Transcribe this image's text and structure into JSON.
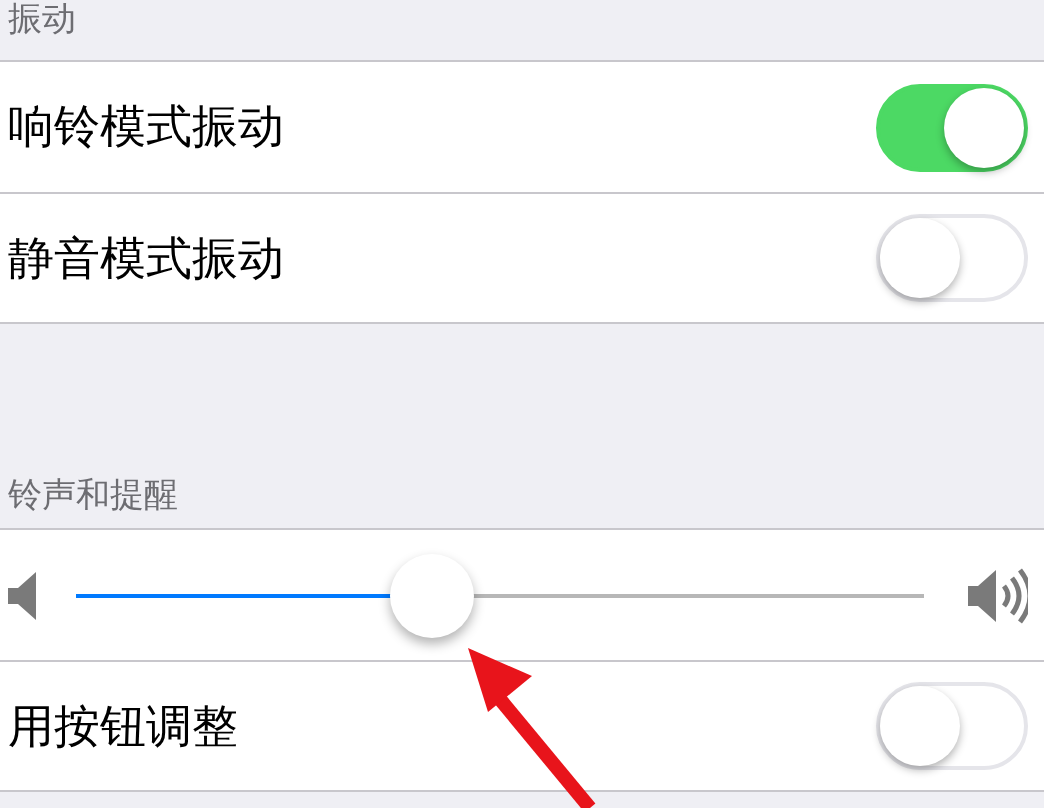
{
  "sections": [
    {
      "header": "振动",
      "rows": [
        {
          "kind": "toggle",
          "label": "响铃模式振动",
          "on": true
        },
        {
          "kind": "toggle",
          "label": "静音模式振动",
          "on": false
        }
      ]
    },
    {
      "header": "铃声和提醒",
      "rows": [
        {
          "kind": "slider",
          "level": 0.42
        },
        {
          "kind": "toggle",
          "label": "用按钮调整",
          "on": false
        }
      ]
    }
  ]
}
